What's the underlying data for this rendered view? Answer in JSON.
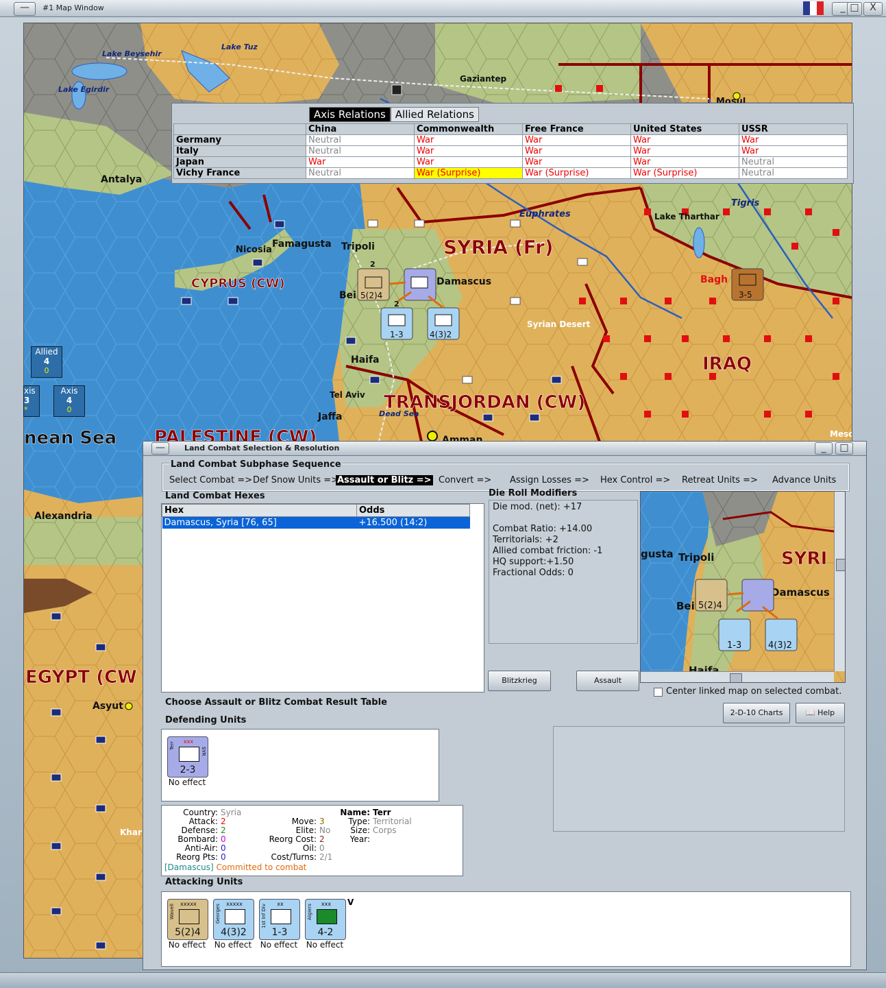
{
  "map_window": {
    "title": "#1 Map Window",
    "buttons": [
      "_",
      "□",
      "X"
    ]
  },
  "map": {
    "labels": {
      "lake_beysehir": "Lake Beysehir",
      "lake_tuz": "Lake Tuz",
      "lake_egirdir": "Lake Egirdir",
      "gaziantep": "Gaziantep",
      "mosul": "Mosul",
      "antalya": "Antalya",
      "euphrates": "Euphrates",
      "tigris": "Tigris",
      "lake_tharthar": "Lake Tharthar",
      "nicosia": "Nicosia",
      "famagusta": "Famagusta",
      "tripoli": "Tripoli",
      "syria": "SYRIA (Fr)",
      "damascus": "Damascus",
      "cyprus": "CYPRUS (CW)",
      "beirut": "Bei",
      "baghdad": "Bagh",
      "syrian_desert": "Syrian Desert",
      "iraq": "IRAQ",
      "haifa": "Haifa",
      "tel_aviv": "Tel Aviv",
      "transjordan": "TRANSJORDAN (CW)",
      "jaffa": "Jaffa",
      "dead_sea": "Dead Sea",
      "amman": "Amman",
      "med_sea": "nean Sea",
      "palestine": "PALESTINE (CW)",
      "alexandria": "Alexandria",
      "egypt": "EGYPT (CW",
      "asyut": "Asyut",
      "khar": "Khar",
      "meso": "Meso"
    },
    "map_units": [
      {
        "str": "5(2)4"
      },
      {
        "str": "1-3"
      },
      {
        "str": "4(3)2"
      },
      {
        "str": "3-5"
      }
    ],
    "stack_counts": [
      "2",
      "2"
    ]
  },
  "info_boxes": {
    "allied": {
      "label": "Allied",
      "a": "4",
      "b": "0"
    },
    "axis": {
      "label": "Axis",
      "a": "4",
      "b": "0"
    },
    "axis_left": {
      "label": "xis",
      "a": "3",
      "b": "*"
    }
  },
  "relations": {
    "tabs": [
      "Axis Relations",
      "Allied Relations"
    ],
    "active_tab": 0,
    "columns": [
      "China",
      "Commonwealth",
      "Free France",
      "United States",
      "USSR"
    ],
    "rows": [
      {
        "name": "Germany",
        "values": [
          "Neutral",
          "War",
          "War",
          "War",
          "War"
        ]
      },
      {
        "name": "Italy",
        "values": [
          "Neutral",
          "War",
          "War",
          "War",
          "War"
        ]
      },
      {
        "name": "Japan",
        "values": [
          "War",
          "War",
          "War",
          "War",
          "Neutral"
        ]
      },
      {
        "name": "Vichy France",
        "values": [
          "Neutral",
          "War (Surprise)",
          "War (Surprise)",
          "War (Surprise)",
          "Neutral"
        ]
      }
    ]
  },
  "combat_window": {
    "title": "Land Combat Selection & Resolution",
    "sequence_title": "Land Combat Subphase Sequence",
    "sequence": [
      "Select Combat =>",
      "Def Snow Units =>",
      "Assault or Blitz =>",
      "Convert =>",
      "Assign Losses =>",
      "Hex Control =>",
      "Retreat Units =>",
      "Advance Units"
    ],
    "current_step": "Assault or Blitz =>",
    "hexes_label": "Land Combat Hexes",
    "hex_columns": [
      "Hex",
      "Odds"
    ],
    "hex_rows": [
      {
        "hex": "Damascus, Syria [76, 65]",
        "odds": "+16.500 (14:2)"
      }
    ],
    "die_roll_label": "Die Roll Modifiers",
    "die_roll_lines": [
      "Die mod. (net): +17",
      "",
      "Combat Ratio: +14.00",
      "Territorials: +2",
      "Allied combat friction: -1",
      "HQ support:+1.50",
      "Fractional Odds: 0"
    ],
    "blitz_button": "Blitzkrieg",
    "assault_button": "Assault",
    "center_checkbox": "Center linked map on selected combat.",
    "charts_button": "2-D-10 Charts",
    "help_button": "Help",
    "choose_label": "Choose Assault or Blitz Combat Result Table",
    "defending_label": "Defending Units",
    "defending_units": [
      {
        "side": "Terr",
        "size": "xxx",
        "nation": "SYR",
        "str": "2-3",
        "effect": "No effect"
      }
    ],
    "details": {
      "country_k": "Country:",
      "country_v": "Syria",
      "attack_k": "Attack:",
      "attack_v": "2",
      "defense_k": "Defense:",
      "defense_v": "2",
      "bombard_k": "Bombard:",
      "bombard_v": "0",
      "antiair_k": "Anti-Air:",
      "antiair_v": "0",
      "reorgpts_k": "Reorg Pts:",
      "reorgpts_v": "0",
      "move_k": "Move:",
      "move_v": "3",
      "elite_k": "Elite:",
      "elite_v": "No",
      "reorgcost_k": "Reorg Cost:",
      "reorgcost_v": "2",
      "oil_k": "Oil:",
      "oil_v": "0",
      "cost_k": "Cost/Turns:",
      "cost_v": "2/1",
      "name_k": "Name:",
      "name_v": "Terr",
      "type_k": "Type:",
      "type_v": "Territorial",
      "size_k": "Size:",
      "size_v": "Corps",
      "year_k": "Year:",
      "location": "[Damascus]",
      "status": "Committed to combat"
    },
    "attacking_label": "Attacking Units",
    "attacking_units": [
      {
        "side": "Wavell",
        "size": "xxxxx",
        "str": "5(2)4",
        "effect": "No effect"
      },
      {
        "side": "Georges",
        "size": "xxxxx",
        "str": "4(3)2",
        "effect": "No effect"
      },
      {
        "side": "1st Inf Div",
        "size": "xx",
        "str": "1-3",
        "effect": "No effect"
      },
      {
        "side": "Algiers",
        "size": "xxx",
        "str": "4-2",
        "effect": "No effect",
        "mark": "V"
      }
    ],
    "minimap": {
      "labels": {
        "gusta": "gusta",
        "tripoli": "Tripoli",
        "syri": "SYRI",
        "damascus": "Damascus",
        "bei": "Bei",
        "haifa": "Haifa"
      },
      "units": [
        {
          "str": "5(2)4"
        },
        {
          "str": "1-3"
        },
        {
          "str": "4(3)2"
        }
      ]
    }
  },
  "colors": {
    "desert": "#e3b35c",
    "sea": "#3f8fd0",
    "hex_border": "#8b0000",
    "flat": "#a9c07a",
    "mountain": "#8a8a8a"
  }
}
